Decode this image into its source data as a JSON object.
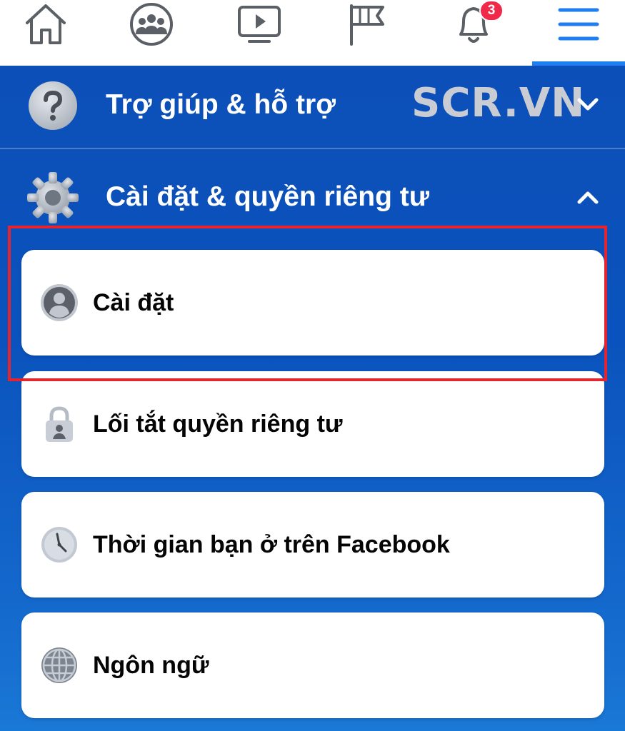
{
  "nav": {
    "items": [
      {
        "icon": "home-icon"
      },
      {
        "icon": "groups-icon"
      },
      {
        "icon": "watch-icon"
      },
      {
        "icon": "pages-flag-icon"
      },
      {
        "icon": "bell-icon",
        "badge": "3"
      },
      {
        "icon": "menu-icon"
      }
    ],
    "active": "menu"
  },
  "sections": {
    "help": {
      "label": "Trợ giúp & hỗ trợ",
      "icon": "question-icon",
      "expanded": false
    },
    "settings": {
      "label": "Cài đặt & quyền riêng tư",
      "icon": "gear-icon",
      "expanded": true
    }
  },
  "watermark": "SCR.VN",
  "cards": [
    {
      "label": "Cài đặt",
      "icon": "profile-icon",
      "highlighted": true
    },
    {
      "label": "Lối tắt quyền riêng tư",
      "icon": "lock-icon"
    },
    {
      "label": "Thời gian bạn ở trên Facebook",
      "icon": "clock-icon"
    },
    {
      "label": "Ngôn ngữ",
      "icon": "globe-icon"
    }
  ],
  "colors": {
    "accent": "#1f7ff0",
    "panel": "#0d4fb8",
    "badge": "#f02849",
    "highlight": "#e5242f"
  }
}
